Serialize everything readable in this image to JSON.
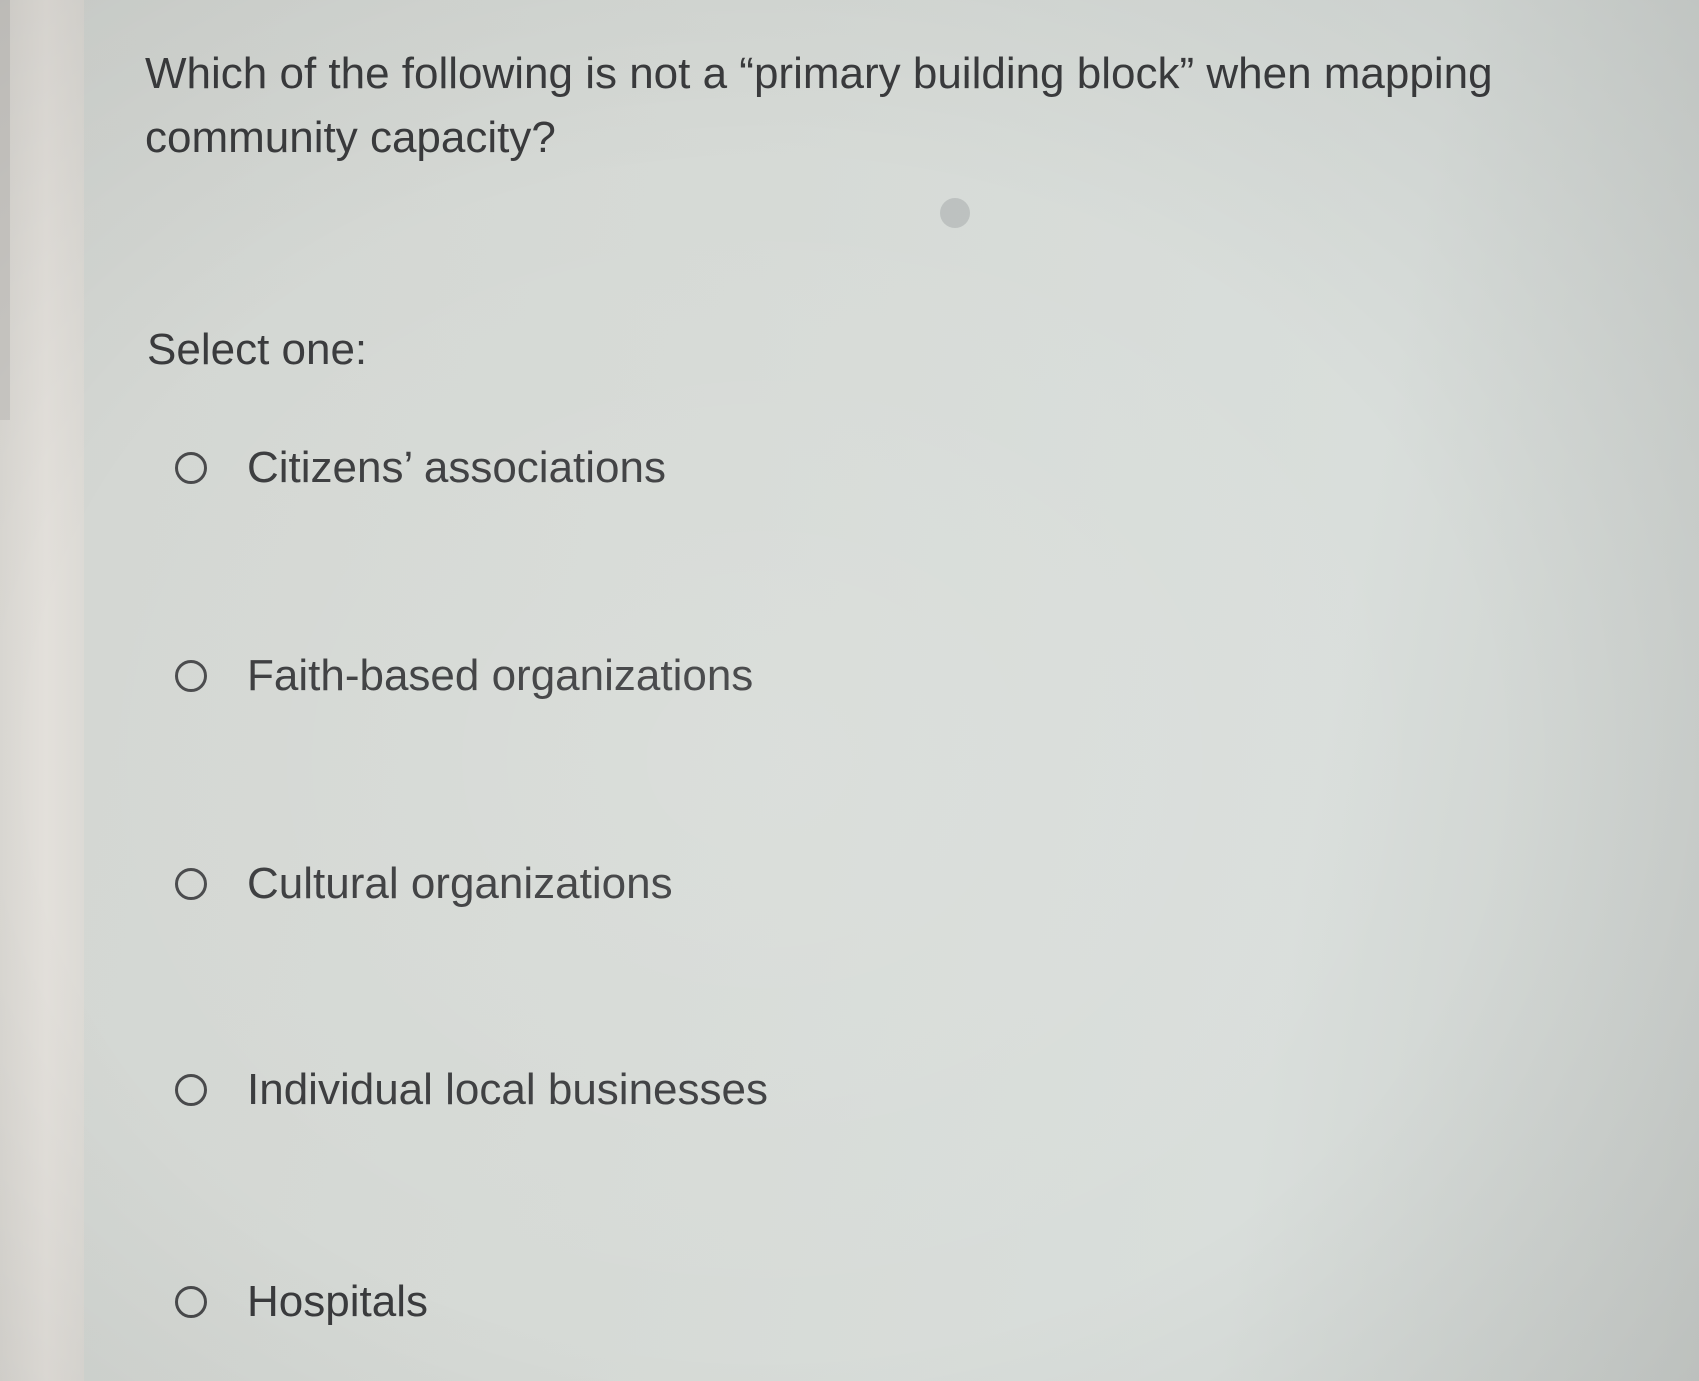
{
  "question": {
    "text": "Which of the following is not a “primary building block” when mapping community capacity?"
  },
  "select_label": "Select one:",
  "options": [
    {
      "label": "Citizens’ associations",
      "selected": false
    },
    {
      "label": "Faith-based organizations",
      "selected": false
    },
    {
      "label": "Cultural organizations",
      "selected": false
    },
    {
      "label": "Individual local businesses",
      "selected": false
    },
    {
      "label": "Hospitals",
      "selected": false
    }
  ],
  "colors": {
    "text": "#3a3b3d",
    "background": "#d6dad6",
    "radio_border": "#48494b"
  }
}
